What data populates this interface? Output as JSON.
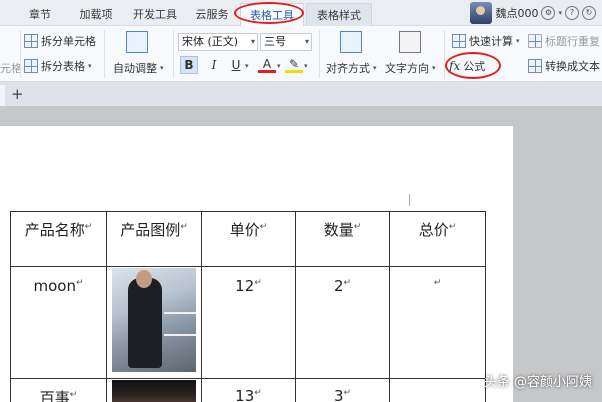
{
  "menu_tabs": [
    "章节",
    "加载项",
    "开发工具",
    "云服务",
    "表格工具",
    "表格样式"
  ],
  "user": {
    "name": "魏点000"
  },
  "ribbon": {
    "left_cut_label": "元格",
    "split_cell": "拆分单元格",
    "split_table": "拆分表格",
    "autofit": "自动调整",
    "font_name": "宋体 (正文)",
    "font_size": "三号",
    "bold": "B",
    "italic": "I",
    "underline": "U",
    "font_color": "A",
    "align": "对齐方式",
    "text_direction": "文字方向",
    "quick_calc": "快速计算",
    "repeat_header": "标题行重复",
    "formula": "公式",
    "convert_text": "转换成文本"
  },
  "doc_tab_bar": {
    "add_label": "+"
  },
  "table": {
    "headers": [
      "产品名称",
      "产品图例",
      "单价",
      "数量",
      "总价"
    ],
    "rows": [
      {
        "name": "moon",
        "price": "12",
        "qty": "2"
      },
      {
        "name": "百事",
        "price": "13",
        "qty": "3"
      }
    ]
  },
  "watermark": "头条 @容颜小阿姨",
  "colors": {
    "annotation_red": "#e02020",
    "active_tab_text": "#2b5ea8"
  }
}
